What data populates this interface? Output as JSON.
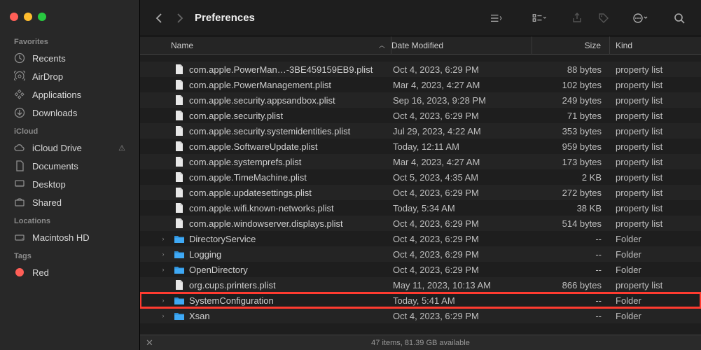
{
  "window": {
    "title": "Preferences"
  },
  "sidebar": {
    "sections": [
      {
        "title": "Favorites",
        "items": [
          {
            "label": "Recents",
            "icon": "clock"
          },
          {
            "label": "AirDrop",
            "icon": "airdrop"
          },
          {
            "label": "Applications",
            "icon": "apps"
          },
          {
            "label": "Downloads",
            "icon": "download"
          }
        ]
      },
      {
        "title": "iCloud",
        "items": [
          {
            "label": "iCloud Drive",
            "icon": "cloud",
            "warn": true
          },
          {
            "label": "Documents",
            "icon": "doc"
          },
          {
            "label": "Desktop",
            "icon": "desktop"
          },
          {
            "label": "Shared",
            "icon": "shared"
          }
        ]
      },
      {
        "title": "Locations",
        "items": [
          {
            "label": "Macintosh HD",
            "icon": "disk"
          }
        ]
      },
      {
        "title": "Tags",
        "items": [
          {
            "label": "Red",
            "icon": "tag-red"
          }
        ]
      }
    ]
  },
  "columns": {
    "name": "Name",
    "date": "Date Modified",
    "size": "Size",
    "kind": "Kind"
  },
  "rows": [
    {
      "type": "file",
      "name": "com.apple.PowerMan…-3BE459159EB9.plist",
      "date": "Oct 4, 2023, 6:29 PM",
      "size": "88 bytes",
      "kind": "property list"
    },
    {
      "type": "file",
      "name": "com.apple.PowerManagement.plist",
      "date": "Mar 4, 2023, 4:27 AM",
      "size": "102 bytes",
      "kind": "property list"
    },
    {
      "type": "file",
      "name": "com.apple.security.appsandbox.plist",
      "date": "Sep 16, 2023, 9:28 PM",
      "size": "249 bytes",
      "kind": "property list"
    },
    {
      "type": "file",
      "name": "com.apple.security.plist",
      "date": "Oct 4, 2023, 6:29 PM",
      "size": "71 bytes",
      "kind": "property list"
    },
    {
      "type": "file",
      "name": "com.apple.security.systemidentities.plist",
      "date": "Jul 29, 2023, 4:22 AM",
      "size": "353 bytes",
      "kind": "property list"
    },
    {
      "type": "file",
      "name": "com.apple.SoftwareUpdate.plist",
      "date": "Today, 12:11 AM",
      "size": "959 bytes",
      "kind": "property list"
    },
    {
      "type": "file",
      "name": "com.apple.systemprefs.plist",
      "date": "Mar 4, 2023, 4:27 AM",
      "size": "173 bytes",
      "kind": "property list"
    },
    {
      "type": "file",
      "name": "com.apple.TimeMachine.plist",
      "date": "Oct 5, 2023, 4:35 AM",
      "size": "2 KB",
      "kind": "property list"
    },
    {
      "type": "file",
      "name": "com.apple.updatesettings.plist",
      "date": "Oct 4, 2023, 6:29 PM",
      "size": "272 bytes",
      "kind": "property list"
    },
    {
      "type": "file",
      "name": "com.apple.wifi.known-networks.plist",
      "date": "Today, 5:34 AM",
      "size": "38 KB",
      "kind": "property list"
    },
    {
      "type": "file",
      "name": "com.apple.windowserver.displays.plist",
      "date": "Oct 4, 2023, 6:29 PM",
      "size": "514 bytes",
      "kind": "property list"
    },
    {
      "type": "folder",
      "name": "DirectoryService",
      "date": "Oct 4, 2023, 6:29 PM",
      "size": "--",
      "kind": "Folder"
    },
    {
      "type": "folder",
      "name": "Logging",
      "date": "Oct 4, 2023, 6:29 PM",
      "size": "--",
      "kind": "Folder"
    },
    {
      "type": "folder",
      "name": "OpenDirectory",
      "date": "Oct 4, 2023, 6:29 PM",
      "size": "--",
      "kind": "Folder"
    },
    {
      "type": "file",
      "name": "org.cups.printers.plist",
      "date": "May 11, 2023, 10:13 AM",
      "size": "866 bytes",
      "kind": "property list"
    },
    {
      "type": "folder",
      "name": "SystemConfiguration",
      "date": "Today, 5:41 AM",
      "size": "--",
      "kind": "Folder",
      "highlight": true
    },
    {
      "type": "folder",
      "name": "Xsan",
      "date": "Oct 4, 2023, 6:29 PM",
      "size": "--",
      "kind": "Folder"
    }
  ],
  "status": {
    "text": "47 items, 81.39 GB available"
  }
}
